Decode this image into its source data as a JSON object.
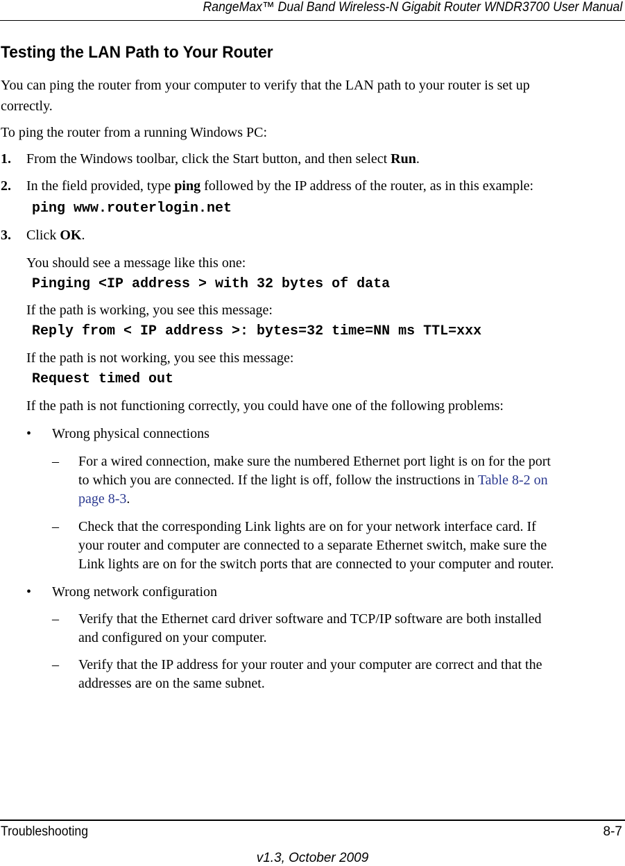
{
  "header": {
    "manual_title": "RangeMax™ Dual Band Wireless-N Gigabit Router WNDR3700 User Manual"
  },
  "section": {
    "title": "Testing the LAN Path to Your Router",
    "intro_line1": "You can ping the router from your computer to verify that the LAN path to your router is set up",
    "intro_line2": "correctly.",
    "lead": "To ping the router from a running Windows PC:"
  },
  "steps": [
    {
      "number": "1.",
      "text_before": "From the Windows toolbar, click the Start button, and then select ",
      "bold": "Run",
      "text_after": "."
    },
    {
      "number": "2.",
      "text_before": "In the field provided, type ",
      "bold": "ping",
      "text_after": " followed by the IP address of the router, as in this example:",
      "code": "ping www.routerlogin.net"
    },
    {
      "number": "3.",
      "text_before": "Click ",
      "bold": "OK",
      "text_after": "."
    }
  ],
  "messages": {
    "expect_label": "You should see a message like this one:",
    "expect_code": "Pinging <IP address > with 32 bytes of data",
    "working_label": "If the path is working, you see this message:",
    "working_code": "Reply from < IP address >: bytes=32 time=NN ms TTL=xxx",
    "not_working_label": "If the path is not working, you see this message:",
    "not_working_code": "Request timed out",
    "problems_label": "If the path is not functioning correctly, you could have one of the following problems:"
  },
  "problems": [
    {
      "bullet": "•",
      "title": "Wrong physical connections",
      "items": [
        {
          "dash": "–",
          "line1": "For a wired connection, make sure the numbered Ethernet port light is on for the port",
          "line2_before": "to which you are connected. If the light is off, follow the instructions in ",
          "link_part1": "Table 8-2 on",
          "link_part2": "page 8-3",
          "line3_after": "."
        },
        {
          "dash": "–",
          "line1": "Check that the corresponding Link lights are on for your network interface card. If",
          "line2": "your router and computer are connected to a separate Ethernet switch, make sure the",
          "line3": "Link lights are on for the switch ports that are connected to your computer and router."
        }
      ]
    },
    {
      "bullet": "•",
      "title": "Wrong network configuration",
      "items": [
        {
          "dash": "–",
          "line1": "Verify that the Ethernet card driver software and TCP/IP software are both installed",
          "line2": "and configured on your computer."
        },
        {
          "dash": "–",
          "line1": "Verify that the IP address for your router and your computer are correct and that the",
          "line2": "addresses are on the same subnet."
        }
      ]
    }
  ],
  "footer": {
    "chapter": "Troubleshooting",
    "page": "8-7",
    "version": "v1.3, October 2009"
  },
  "colors": {
    "link": "#2b3990",
    "text": "#000000",
    "background": "#ffffff"
  }
}
